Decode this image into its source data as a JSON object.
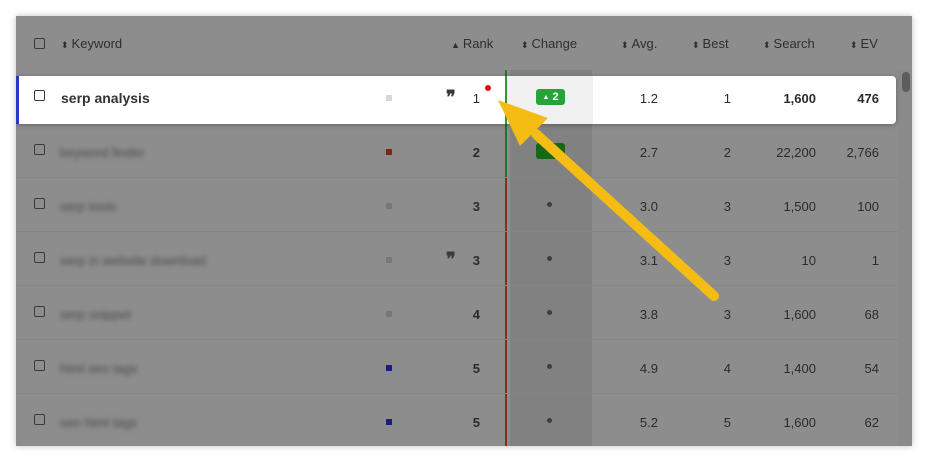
{
  "columns": {
    "keyword": "Keyword",
    "rank": "Rank",
    "change": "Change",
    "avg": "Avg.",
    "best": "Best",
    "search": "Search",
    "ev": "EV"
  },
  "sort_icon": "sort-arrows-icon",
  "highlighted_row": {
    "keyword": "serp analysis",
    "rank": "1",
    "change": "2",
    "avg": "1.2",
    "best": "1",
    "search": "1,600",
    "ev": "476",
    "has_quote": true,
    "color": "#cfcfcf"
  },
  "rows": [
    {
      "keyword": "keyword finder",
      "rank": "2",
      "change_badge": true,
      "avg": "2.7",
      "best": "2",
      "search": "22,200",
      "ev": "2,766",
      "quote": false,
      "color": "#7a2a10"
    },
    {
      "keyword": "serp tools",
      "rank": "3",
      "change_badge": false,
      "avg": "3.0",
      "best": "3",
      "search": "1,500",
      "ev": "100",
      "quote": false,
      "color": "#777777"
    },
    {
      "keyword": "serp in website download",
      "rank": "3",
      "change_badge": false,
      "avg": "3.1",
      "best": "3",
      "search": "10",
      "ev": "1",
      "quote": true,
      "color": "#777777"
    },
    {
      "keyword": "serp snippet",
      "rank": "4",
      "change_badge": false,
      "avg": "3.8",
      "best": "3",
      "search": "1,600",
      "ev": "68",
      "quote": false,
      "color": "#777777"
    },
    {
      "keyword": "html seo tags",
      "rank": "5",
      "change_badge": false,
      "avg": "4.9",
      "best": "4",
      "search": "1,400",
      "ev": "54",
      "quote": false,
      "color": "#1a1a8a"
    },
    {
      "keyword": "seo html tags",
      "rank": "5",
      "change_badge": false,
      "avg": "5.2",
      "best": "5",
      "search": "1,600",
      "ev": "62",
      "quote": false,
      "color": "#1a1a8a"
    }
  ],
  "colors": {
    "highlight_bar": "#2a35c9",
    "badge_green": "#2aa23a",
    "arrow": "#f5bc13",
    "new_dot": "#e01010"
  }
}
